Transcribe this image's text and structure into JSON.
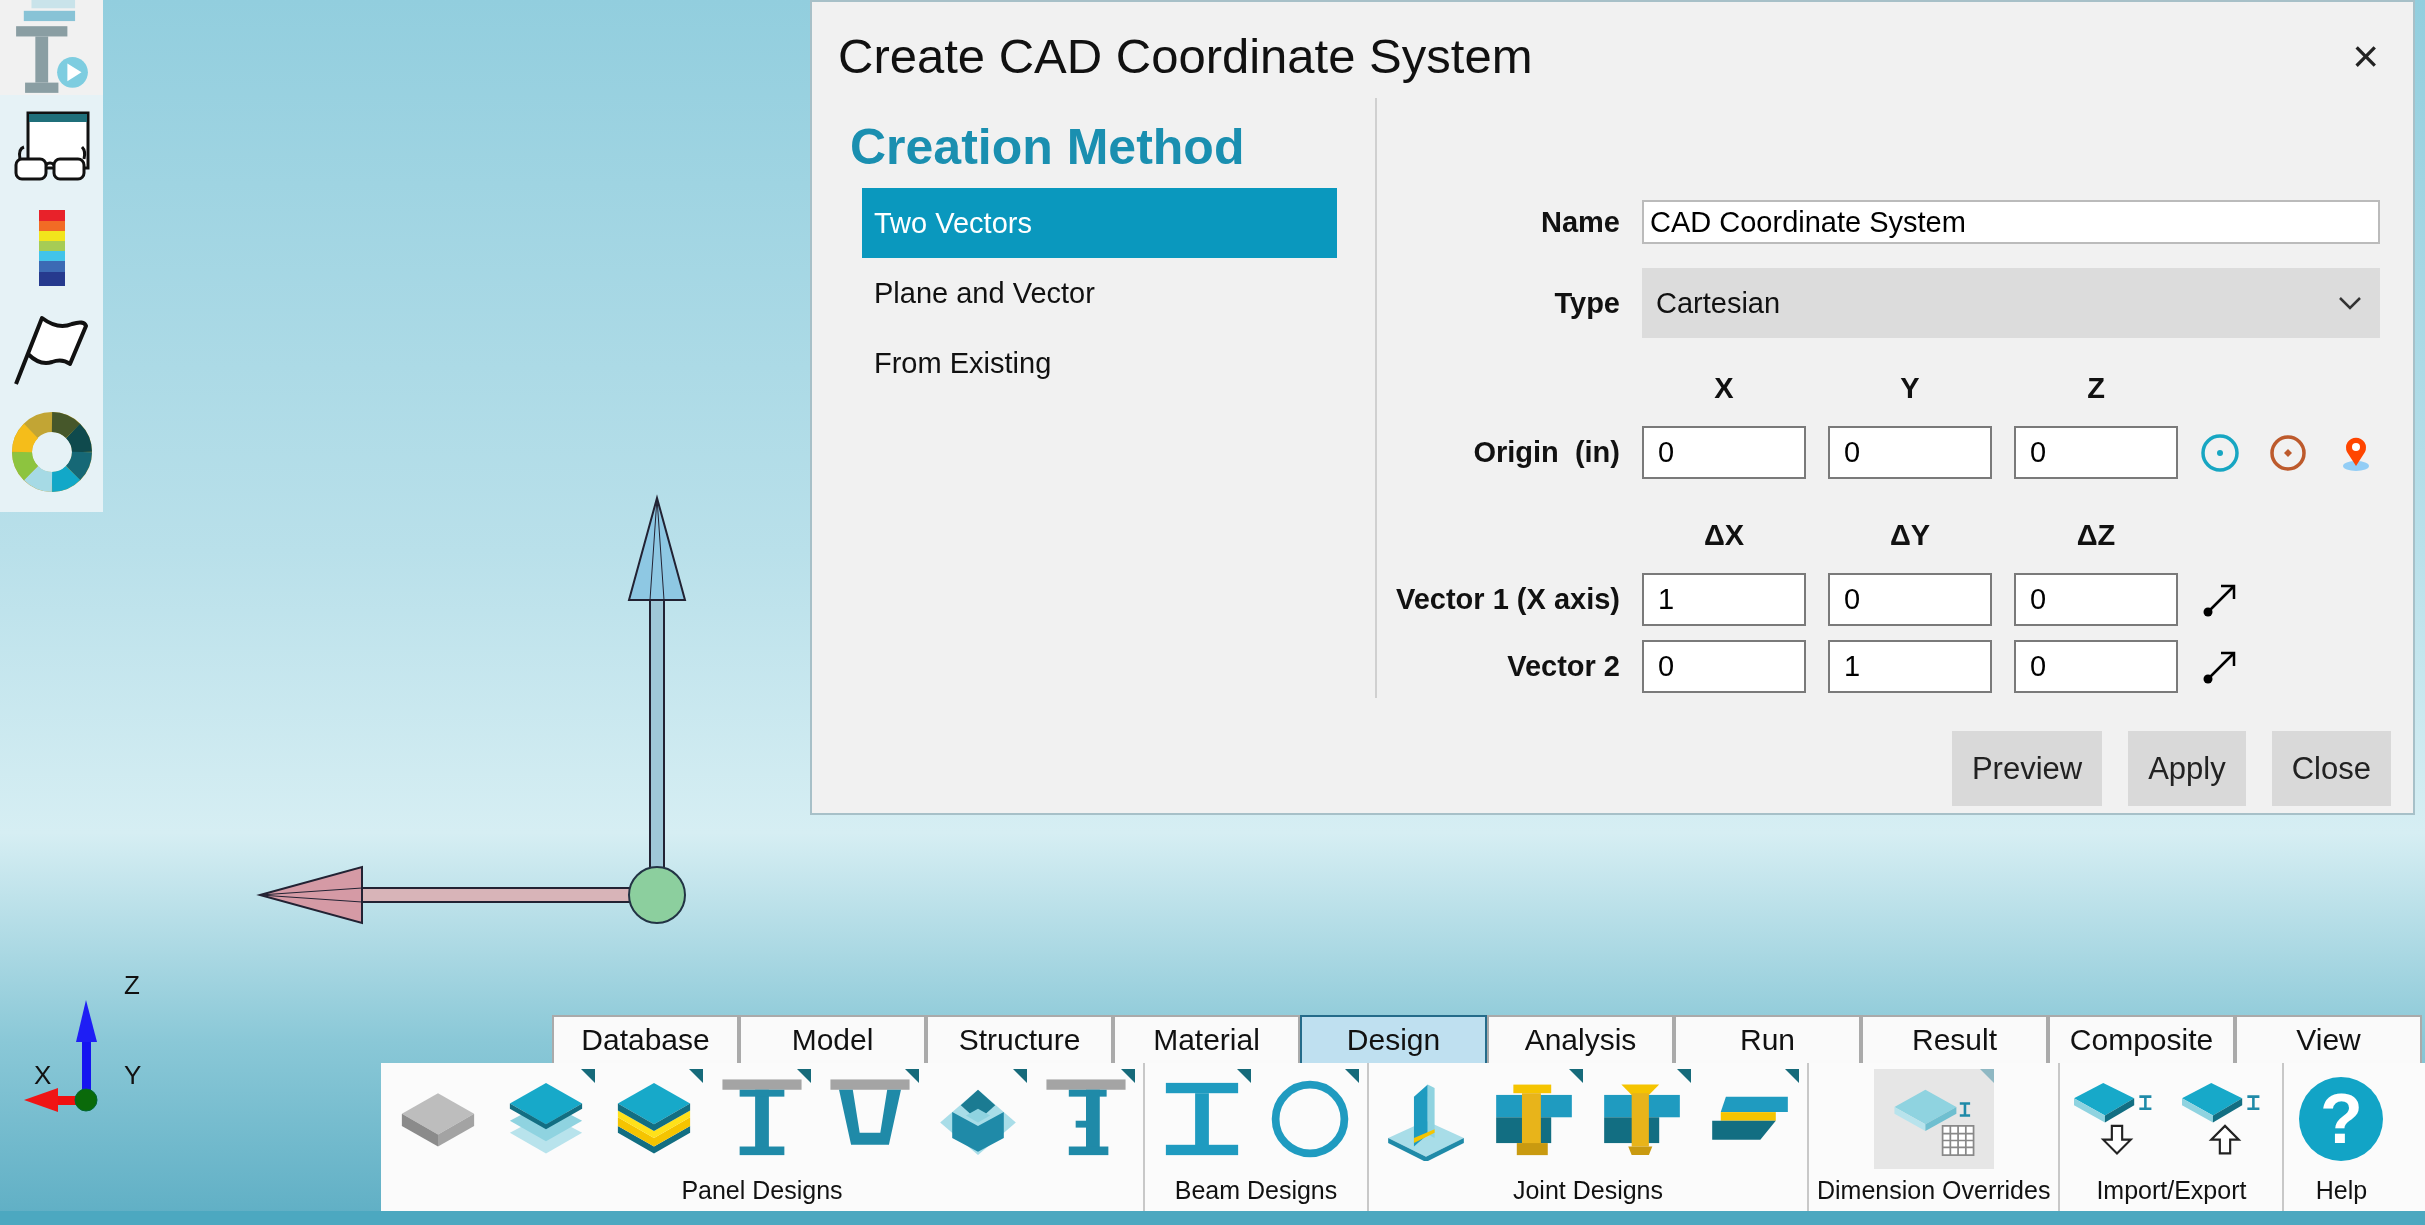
{
  "viewport": {
    "triad": {
      "labels": [
        "X",
        "Y",
        "Z"
      ]
    }
  },
  "dialog": {
    "title": "Create CAD Coordinate System",
    "close": "×",
    "section_title": "Creation Method",
    "methods": [
      {
        "label": "Two Vectors",
        "selected": true
      },
      {
        "label": "Plane and Vector",
        "selected": false
      },
      {
        "label": "From Existing",
        "selected": false
      }
    ],
    "name": {
      "label": "Name",
      "value": "CAD Coordinate System"
    },
    "type": {
      "label": "Type",
      "value": "Cartesian"
    },
    "column_headers": [
      "X",
      "Y",
      "Z"
    ],
    "origin": {
      "label": "Origin  (in)",
      "values": [
        "0",
        "0",
        "0"
      ]
    },
    "delta_headers": [
      "ΔX",
      "ΔY",
      "ΔZ"
    ],
    "vectors": [
      {
        "label": "Vector 1 (X axis)",
        "values": [
          "1",
          "0",
          "0"
        ]
      },
      {
        "label": "Vector 2",
        "values": [
          "0",
          "1",
          "0"
        ]
      }
    ],
    "buttons": [
      "Preview",
      "Apply",
      "Close"
    ]
  },
  "ribbon": {
    "tabs": [
      {
        "label": "Database",
        "selected": false
      },
      {
        "label": "Model",
        "selected": false
      },
      {
        "label": "Structure",
        "selected": false
      },
      {
        "label": "Material",
        "selected": false
      },
      {
        "label": "Design",
        "selected": true
      },
      {
        "label": "Analysis",
        "selected": false
      },
      {
        "label": "Run",
        "selected": false
      },
      {
        "label": "Result",
        "selected": false
      },
      {
        "label": "Composite",
        "selected": false
      },
      {
        "label": "View",
        "selected": false
      }
    ],
    "groups": [
      {
        "label": "Panel Designs",
        "tools": [
          {
            "kind": "plate",
            "flyout": false,
            "selected": false
          },
          {
            "kind": "stack",
            "flyout": true,
            "selected": false
          },
          {
            "kind": "sandwich",
            "flyout": true,
            "selected": false
          },
          {
            "kind": "tee",
            "flyout": true,
            "selected": false
          },
          {
            "kind": "trough",
            "flyout": true,
            "selected": false
          },
          {
            "kind": "grid",
            "flyout": true,
            "selected": false
          },
          {
            "kind": "stub",
            "flyout": true,
            "selected": false
          }
        ]
      },
      {
        "label": "Beam Designs",
        "tools": [
          {
            "kind": "ibeam",
            "flyout": true,
            "selected": false
          },
          {
            "kind": "tube",
            "flyout": true,
            "selected": false
          }
        ]
      },
      {
        "label": "Joint Designs",
        "tools": [
          {
            "kind": "fillet",
            "flyout": false,
            "selected": false
          },
          {
            "kind": "bolt",
            "flyout": true,
            "selected": false
          },
          {
            "kind": "rivet",
            "flyout": true,
            "selected": false
          },
          {
            "kind": "lap",
            "flyout": true,
            "selected": false
          }
        ]
      },
      {
        "label": "Dimension Overrides",
        "tools": [
          {
            "kind": "overrides",
            "flyout": true,
            "selected": true
          }
        ]
      },
      {
        "label": "Import/Export",
        "tools": [
          {
            "kind": "export",
            "flyout": false,
            "selected": false
          },
          {
            "kind": "import",
            "flyout": false,
            "selected": false
          }
        ]
      },
      {
        "label": "Help",
        "tools": [
          {
            "kind": "help",
            "flyout": false,
            "selected": false,
            "symbol": "?"
          }
        ]
      }
    ]
  }
}
